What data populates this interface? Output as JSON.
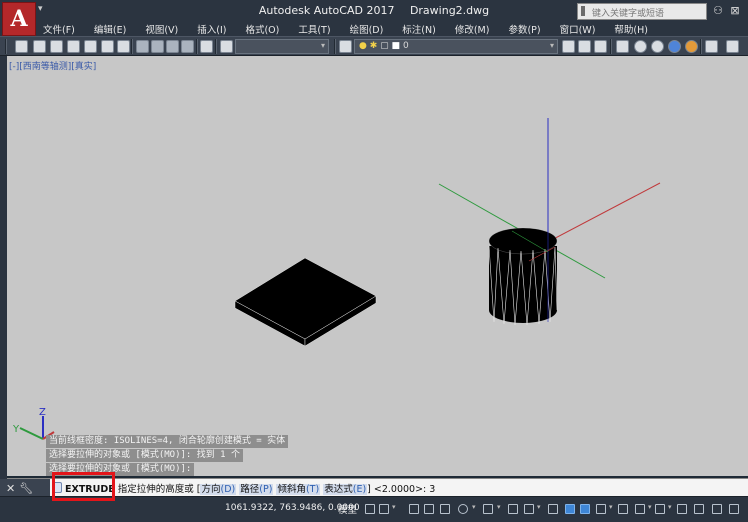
{
  "titlebar": {
    "app_logo": "A",
    "app_name": "Autodesk AutoCAD 2017",
    "file_name": "Drawing2.dwg",
    "search_placeholder": "键入关键字或短语"
  },
  "menu": [
    "文件(F)",
    "编辑(E)",
    "视图(V)",
    "插入(I)",
    "格式(O)",
    "工具(T)",
    "绘图(D)",
    "标注(N)",
    "修改(M)",
    "参数(P)",
    "窗口(W)",
    "帮助(H)"
  ],
  "toolbar": {
    "layer_value": "0"
  },
  "viewport": {
    "label": "[-][西南等轴测][真实]",
    "background": "#c7c7c7",
    "axis_colors": {
      "x": "#c0393b",
      "y": "#2e9a3e",
      "z": "#2b2fc2"
    },
    "ucs": {
      "z_label": "Z",
      "y_label": "Y",
      "x_label": "X"
    }
  },
  "command_history": [
    "当前线框密度:  ISOLINES=4, 闭合轮廓创建模式 = 实体",
    "选择要拉伸的对象或 [模式(MO)]: 找到 1 个",
    "选择要拉伸的对象或 [模式(MO)]:"
  ],
  "command_line": {
    "command": "EXTRUDE",
    "prompt": "指定拉伸的高度或 [",
    "options": [
      {
        "label": "方向",
        "key": "(D)"
      },
      {
        "label": "路径",
        "key": "(P)"
      },
      {
        "label": "倾斜角",
        "key": "(T)"
      },
      {
        "label": "表达式",
        "key": "(E)"
      }
    ],
    "suffix": "] <2.0000>: ",
    "input": "3"
  },
  "statusbar": {
    "coordinates": "1061.9322, 763.9486, 0.0000",
    "model_tab": "模型"
  }
}
